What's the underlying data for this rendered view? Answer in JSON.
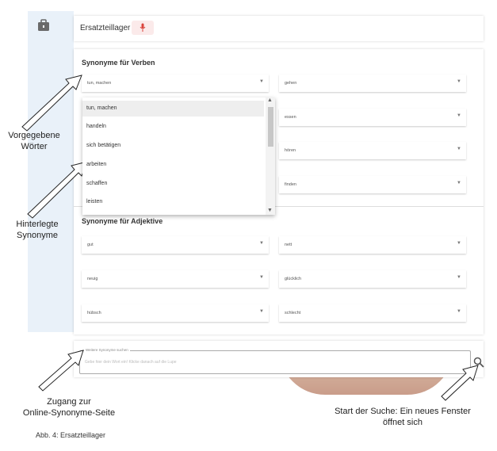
{
  "app": {
    "header_title": "Ersatzteillager",
    "mic_icon": "microphone-icon",
    "side_icon": "briefcase-icon"
  },
  "verbs": {
    "title": "Synonyme für Verben",
    "fields": [
      {
        "value": "tun, machen"
      },
      {
        "value": "gehen"
      },
      {
        "value": "essen"
      },
      {
        "value": "hören"
      },
      {
        "value": "finden"
      }
    ],
    "dropdown_options": [
      "tun, machen",
      "handeln",
      "sich betätigen",
      "arbeiten",
      "schaffen",
      "leisten"
    ]
  },
  "adjectives": {
    "title": "Synonyme für Adjektive",
    "fields": [
      {
        "value": "gut"
      },
      {
        "value": "nett"
      },
      {
        "value": "neuig"
      },
      {
        "value": "glücklich"
      },
      {
        "value": "hübsch"
      },
      {
        "value": "schlecht"
      }
    ]
  },
  "search": {
    "legend": "Weitere Synonyme suchen",
    "placeholder": "Gebe hier dein Wort ein! Klicke danach auf die Lupe",
    "icon": "search-icon"
  },
  "annotations": {
    "vorgegebene": "Vorgegebene\nWörter",
    "hinterlegte": "Hinterlegte\nSynonyme",
    "zugang": "Zugang zur\nOnline-Synonyme-Seite",
    "start": "Start der Suche: Ein neues Fenster\nöffnet sich"
  },
  "caption": "Abb. 4: Ersatzteillager",
  "colors": {
    "sidebar": "#e9f1f9",
    "mic": "#d9433b"
  }
}
